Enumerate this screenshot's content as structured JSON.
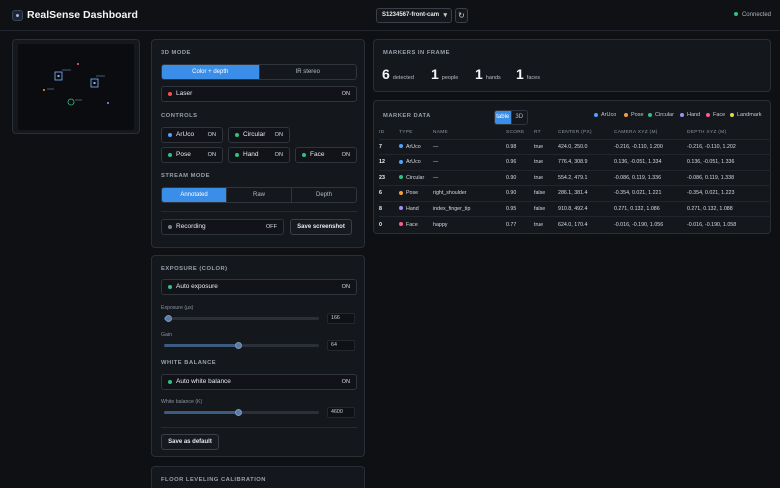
{
  "header": {
    "title": "RealSense Dashboard",
    "camera": "S1234567-front-cam",
    "status": "Connected",
    "refresh_icon": "refresh-icon"
  },
  "viewer": {
    "markers": [
      "ArUco",
      "Pose",
      "Circular",
      "Hand",
      "Face"
    ]
  },
  "mode3d": {
    "title": "3D MODE",
    "options": [
      "Color + depth",
      "IR stereo"
    ],
    "laser": {
      "label": "Laser",
      "state": "ON"
    }
  },
  "controls": {
    "title": "CONTROLS",
    "items": [
      {
        "label": "ArUco",
        "state": "ON",
        "color": "#4fa3ff"
      },
      {
        "label": "Circular",
        "state": "ON",
        "color": "#2ec27e"
      },
      {
        "label": "Pose",
        "state": "ON",
        "color": "#f59e3b"
      },
      {
        "label": "Hand",
        "state": "ON",
        "color": "#2ec27e"
      },
      {
        "label": "Face",
        "state": "ON",
        "color": "#2ec27e"
      }
    ]
  },
  "stream": {
    "title": "STREAM MODE",
    "options": [
      "Annotated",
      "Raw",
      "Depth"
    ],
    "recording": {
      "label": "Recording",
      "state": "OFF"
    },
    "save_label": "Save screenshot"
  },
  "exposure": {
    "title": "EXPOSURE (COLOR)",
    "auto": {
      "label": "Auto exposure",
      "state": "ON"
    },
    "exposure_label": "Exposure (µs)",
    "exposure_value": "166",
    "exposure_fraction": 0.03,
    "gain_label": "Gain",
    "gain_value": "64",
    "gain_fraction": 0.48
  },
  "white_balance": {
    "title": "WHITE BALANCE",
    "auto": {
      "label": "Auto white balance",
      "state": "ON"
    },
    "wb_label": "White balance (K)",
    "wb_value": "4600",
    "wb_fraction": 0.48,
    "default_label": "Save as default"
  },
  "floor": {
    "title": "FLOOR LEVELING CALIBRATION"
  },
  "markers_in_frame": {
    "title": "MARKERS IN FRAME",
    "stats": [
      {
        "n": "6",
        "label": "detected"
      },
      {
        "n": "1",
        "label": "people"
      },
      {
        "n": "1",
        "label": "hands"
      },
      {
        "n": "1",
        "label": "faces"
      }
    ]
  },
  "marker_data": {
    "title": "MARKER DATA",
    "view_options": [
      "table",
      "3D"
    ],
    "legend": [
      {
        "label": "ArUco",
        "color": "#4fa3ff"
      },
      {
        "label": "Pose",
        "color": "#f59e3b"
      },
      {
        "label": "Circular",
        "color": "#2ec27e"
      },
      {
        "label": "Hand",
        "color": "#a78bfa"
      },
      {
        "label": "Face",
        "color": "#ff5c8a"
      },
      {
        "label": "Landmark",
        "color": "#e8d44d"
      }
    ],
    "columns": [
      "ID",
      "TYPE",
      "NAME",
      "SCORE",
      "RT",
      "CENTER (PX)",
      "CAMERA XYZ (M)",
      "DEPTH XYZ (M)"
    ],
    "rows": [
      {
        "id": "7",
        "type": "ArUco",
        "color": "#4fa3ff",
        "name": "—",
        "score": "0.98",
        "rt": "true",
        "center": "424.0, 250.0",
        "cam": "-0.216, -0.110, 1.200",
        "depth": "-0.216, -0.110, 1.202"
      },
      {
        "id": "12",
        "type": "ArUco",
        "color": "#4fa3ff",
        "name": "—",
        "score": "0.96",
        "rt": "true",
        "center": "776.4, 308.9",
        "cam": "0.136, -0.051, 1.334",
        "depth": "0.136, -0.051, 1.336"
      },
      {
        "id": "23",
        "type": "Circular",
        "color": "#2ec27e",
        "name": "—",
        "score": "0.90",
        "rt": "true",
        "center": "554.2, 479.1",
        "cam": "-0.086, 0.119, 1.336",
        "depth": "-0.086, 0.119, 1.338"
      },
      {
        "id": "6",
        "type": "Pose",
        "color": "#f59e3b",
        "name": "right_shoulder",
        "score": "0.90",
        "rt": "false",
        "center": "286.1, 381.4",
        "cam": "-0.354, 0.021, 1.221",
        "depth": "-0.354, 0.021, 1.223"
      },
      {
        "id": "8",
        "type": "Hand",
        "color": "#a78bfa",
        "name": "index_finger_tip",
        "score": "0.95",
        "rt": "false",
        "center": "910.8, 492.4",
        "cam": "0.271, 0.132, 1.086",
        "depth": "0.271, 0.132, 1.088"
      },
      {
        "id": "0",
        "type": "Face",
        "color": "#ff5c8a",
        "name": "happy",
        "score": "0.77",
        "rt": "true",
        "center": "624.0, 170.4",
        "cam": "-0.016, -0.190, 1.056",
        "depth": "-0.016, -0.190, 1.058"
      }
    ]
  }
}
